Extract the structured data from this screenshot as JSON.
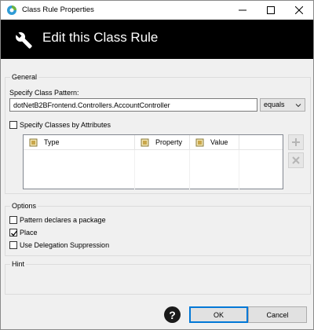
{
  "window": {
    "title": "Class Rule Properties",
    "app_icon": "eclipse-app-icon"
  },
  "header": {
    "title": "Edit this Class Rule",
    "icon": "wrench-icon",
    "background": "#000000"
  },
  "general": {
    "legend": "General",
    "pattern_label": "Specify Class Pattern:",
    "pattern_value": "dotNetB2BFrontend.Controllers.AccountController",
    "match_select": "equals",
    "attributes_checkbox": {
      "label": "Specify Classes by Attributes",
      "checked": false
    },
    "table": {
      "columns": [
        "Type",
        "Property",
        "Value"
      ],
      "rows": []
    },
    "side_buttons": [
      "add-icon",
      "remove-icon"
    ]
  },
  "options": {
    "legend": "Options",
    "items": [
      {
        "label": "Pattern declares a package",
        "checked": false
      },
      {
        "label": "Place",
        "checked": true
      },
      {
        "label": "Use Delegation Suppression",
        "checked": false
      }
    ]
  },
  "hint": {
    "legend": "Hint"
  },
  "footer": {
    "help": "?",
    "ok": "OK",
    "cancel": "Cancel"
  },
  "colors": {
    "accent": "#0078d7",
    "app_icon_blue": "#2e9bd6",
    "app_icon_green": "#6cb33f"
  }
}
